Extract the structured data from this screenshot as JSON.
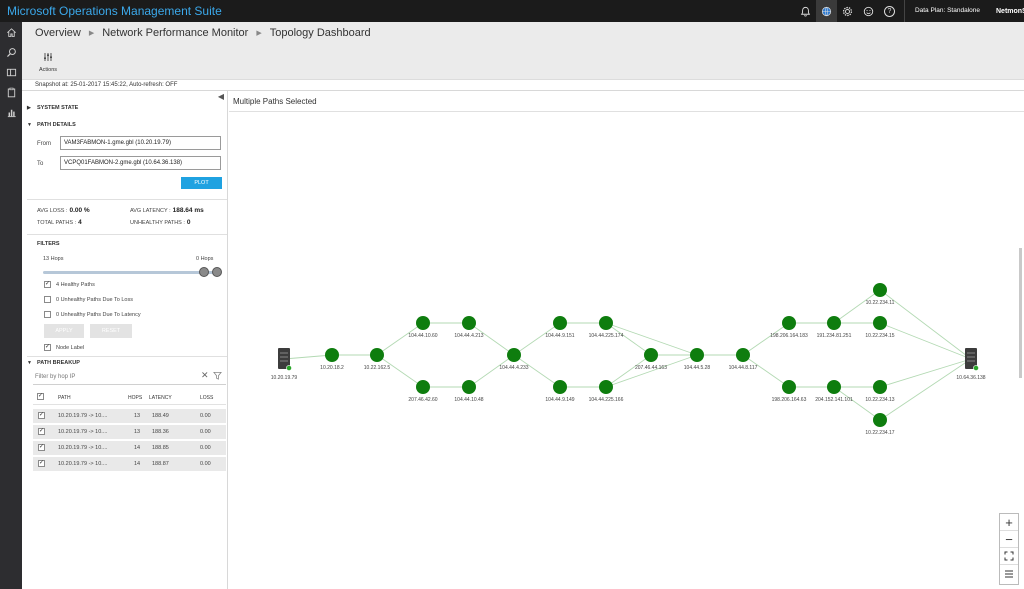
{
  "app": {
    "title": "Microsoft Operations Management Suite",
    "data_plan": "Data Plan: Standalone",
    "user": "NetmonSE",
    "top_icons": [
      "bell-icon",
      "globe-icon",
      "gear-icon",
      "smiley-icon",
      "help-icon"
    ]
  },
  "leftrail": [
    "home-icon",
    "search-icon",
    "dashboard-icon",
    "clipboard-icon",
    "chart-icon"
  ],
  "breadcrumb": [
    "Overview",
    "Network Performance Monitor",
    "Topology Dashboard"
  ],
  "toolbar": {
    "actions_label": "Actions"
  },
  "snapshot": "Snapshot at: 25-01-2017 15:45:22, Auto-refresh: OFF",
  "panel": {
    "system_state": "SYSTEM STATE",
    "path_details": "PATH DETAILS",
    "from_label": "From",
    "from_value": "VAM3FABMON-1.gme.gbl (10.20.19.79)",
    "to_label": "To",
    "to_value": "VCPQ01FABMON-2.gme.gbl (10.64.36.138)",
    "plot_label": "PLOT",
    "avg_loss_label": "AVG LOSS :",
    "avg_loss_value": "0.00 %",
    "avg_latency_label": "AVG LATENCY :",
    "avg_latency_value": "188.64 ms",
    "total_paths_label": "TOTAL PATHS :",
    "total_paths_value": "4",
    "unhealthy_paths_label": "UNHEALTHY PATHS :",
    "unhealthy_paths_value": "0",
    "filters": "FILTERS",
    "hops_left": "13 Hops",
    "hops_right": "0 Hops",
    "checks": [
      {
        "label": "4 Healthy Paths",
        "checked": true
      },
      {
        "label": "0 Unhealthy Paths Due To Loss",
        "checked": false
      },
      {
        "label": "0 Unhealthy Paths Due To Latency",
        "checked": false
      }
    ],
    "apply_label": "APPLY",
    "reset_label": "RESET",
    "node_label": "Node Label",
    "path_breakup": "PATH BREAKUP",
    "filter_placeholder": "Filter by hop IP",
    "table": {
      "headers": [
        "PATH",
        "HOPS",
        "LATENCY",
        "LOSS"
      ],
      "rows": [
        [
          "10.20.19.79 -> 10....",
          "13",
          "188.49",
          "0.00"
        ],
        [
          "10.20.19.79 -> 10....",
          "13",
          "188.36",
          "0.00"
        ],
        [
          "10.20.19.79 -> 10....",
          "14",
          "188.85",
          "0.00"
        ],
        [
          "10.20.19.79 -> 10....",
          "14",
          "188.87",
          "0.00"
        ]
      ]
    }
  },
  "main": {
    "title": "Multiple Paths Selected",
    "nodes": [
      {
        "id": "src",
        "label": "10.20.19.79",
        "type": "server"
      },
      {
        "id": "n1",
        "label": "10.20.18.2",
        "type": "hop"
      },
      {
        "id": "n2",
        "label": "10.22.162.5",
        "type": "hop"
      },
      {
        "id": "n3",
        "label": "104.44.10.60",
        "type": "hop"
      },
      {
        "id": "n4",
        "label": "207.46.42.60",
        "type": "hop"
      },
      {
        "id": "n5",
        "label": "104.44.4.213",
        "type": "hop"
      },
      {
        "id": "n6",
        "label": "104.44.10.48",
        "type": "hop"
      },
      {
        "id": "n7",
        "label": "104.44.4.233",
        "type": "hop"
      },
      {
        "id": "n8",
        "label": "104.44.9.151",
        "type": "hop"
      },
      {
        "id": "n9",
        "label": "104.44.9.149",
        "type": "hop"
      },
      {
        "id": "n10",
        "label": "104.44.225.174",
        "type": "hop"
      },
      {
        "id": "n11",
        "label": "104.44.225.166",
        "type": "hop"
      },
      {
        "id": "n12",
        "label": "207.46.44.163",
        "type": "hop"
      },
      {
        "id": "n13",
        "label": "104.44.5.28",
        "type": "hop"
      },
      {
        "id": "n14",
        "label": "104.44.8.117",
        "type": "hop"
      },
      {
        "id": "n15",
        "label": "198.206.164.183",
        "type": "hop"
      },
      {
        "id": "n16",
        "label": "198.206.164.63",
        "type": "hop"
      },
      {
        "id": "n17",
        "label": "191.234.81.251",
        "type": "hop"
      },
      {
        "id": "n18",
        "label": "204.152.141.101",
        "type": "hop"
      },
      {
        "id": "n19",
        "label": "10.22.234.11",
        "type": "hop"
      },
      {
        "id": "n20",
        "label": "10.22.234.15",
        "type": "hop"
      },
      {
        "id": "n21",
        "label": "10.22.234.13",
        "type": "hop"
      },
      {
        "id": "n22",
        "label": "10.22.234.17",
        "type": "hop"
      },
      {
        "id": "dst",
        "label": "10.64.36.138",
        "type": "server"
      }
    ],
    "edges": [
      [
        "src",
        "n1"
      ],
      [
        "n1",
        "n2"
      ],
      [
        "n2",
        "n3"
      ],
      [
        "n2",
        "n4"
      ],
      [
        "n3",
        "n5"
      ],
      [
        "n4",
        "n6"
      ],
      [
        "n5",
        "n7"
      ],
      [
        "n6",
        "n7"
      ],
      [
        "n7",
        "n8"
      ],
      [
        "n7",
        "n9"
      ],
      [
        "n8",
        "n10"
      ],
      [
        "n9",
        "n11"
      ],
      [
        "n10",
        "n12"
      ],
      [
        "n11",
        "n12"
      ],
      [
        "n12",
        "n13"
      ],
      [
        "n10",
        "n13"
      ],
      [
        "n11",
        "n13"
      ],
      [
        "n13",
        "n14"
      ],
      [
        "n14",
        "n15"
      ],
      [
        "n14",
        "n16"
      ],
      [
        "n15",
        "n17"
      ],
      [
        "n16",
        "n18"
      ],
      [
        "n17",
        "n19"
      ],
      [
        "n17",
        "n20"
      ],
      [
        "n18",
        "n21"
      ],
      [
        "n18",
        "n22"
      ],
      [
        "n19",
        "dst"
      ],
      [
        "n20",
        "dst"
      ],
      [
        "n21",
        "dst"
      ],
      [
        "n22",
        "dst"
      ]
    ],
    "zoom_controls": [
      "zoom-in-icon",
      "zoom-out-icon",
      "fit-icon",
      "legend-icon"
    ],
    "colors": {
      "node": "#0e7d0e",
      "edge": "#b3d9b3",
      "accent": "#1fa2e1"
    }
  }
}
